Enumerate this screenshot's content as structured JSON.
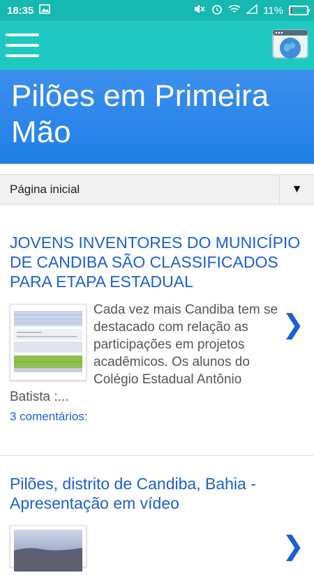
{
  "status_bar": {
    "time": "18:35",
    "battery": "11%",
    "battery_level": 0.11,
    "icons": [
      "gallery-icon",
      "mute-icon",
      "alarm-icon",
      "wifi-icon",
      "signal-icon",
      "battery-icon"
    ]
  },
  "app_bar": {
    "menu_icon": "hamburger-menu-icon",
    "browser_icon": "browser-globe-icon"
  },
  "blog": {
    "title": "Pilões em Primeira Mão"
  },
  "nav": {
    "selected": "Página inicial",
    "arrow": "▼"
  },
  "posts": [
    {
      "title": "JOVENS INVENTORES DO MUNICÍPIO DE CANDIBA SÃO CLASSIFICADOS PARA ETAPA ESTADUAL",
      "snippet": "Cada vez mais Candiba tem se destacado com relação as participações em projetos acadêmicos. Os alunos do Colégio Estadual Antônio Batista :...",
      "comments": "3 comentários:",
      "chevron": "❯"
    },
    {
      "title": "Pilões, distrito de Candiba, Bahia - Apresentação em vídeo",
      "chevron": "❯"
    }
  ],
  "colors": {
    "status_bar": "#16b8b0",
    "app_bar": "#1fc9c1",
    "header_blue": "#2f86ec",
    "link_blue": "#1a5fd6"
  }
}
